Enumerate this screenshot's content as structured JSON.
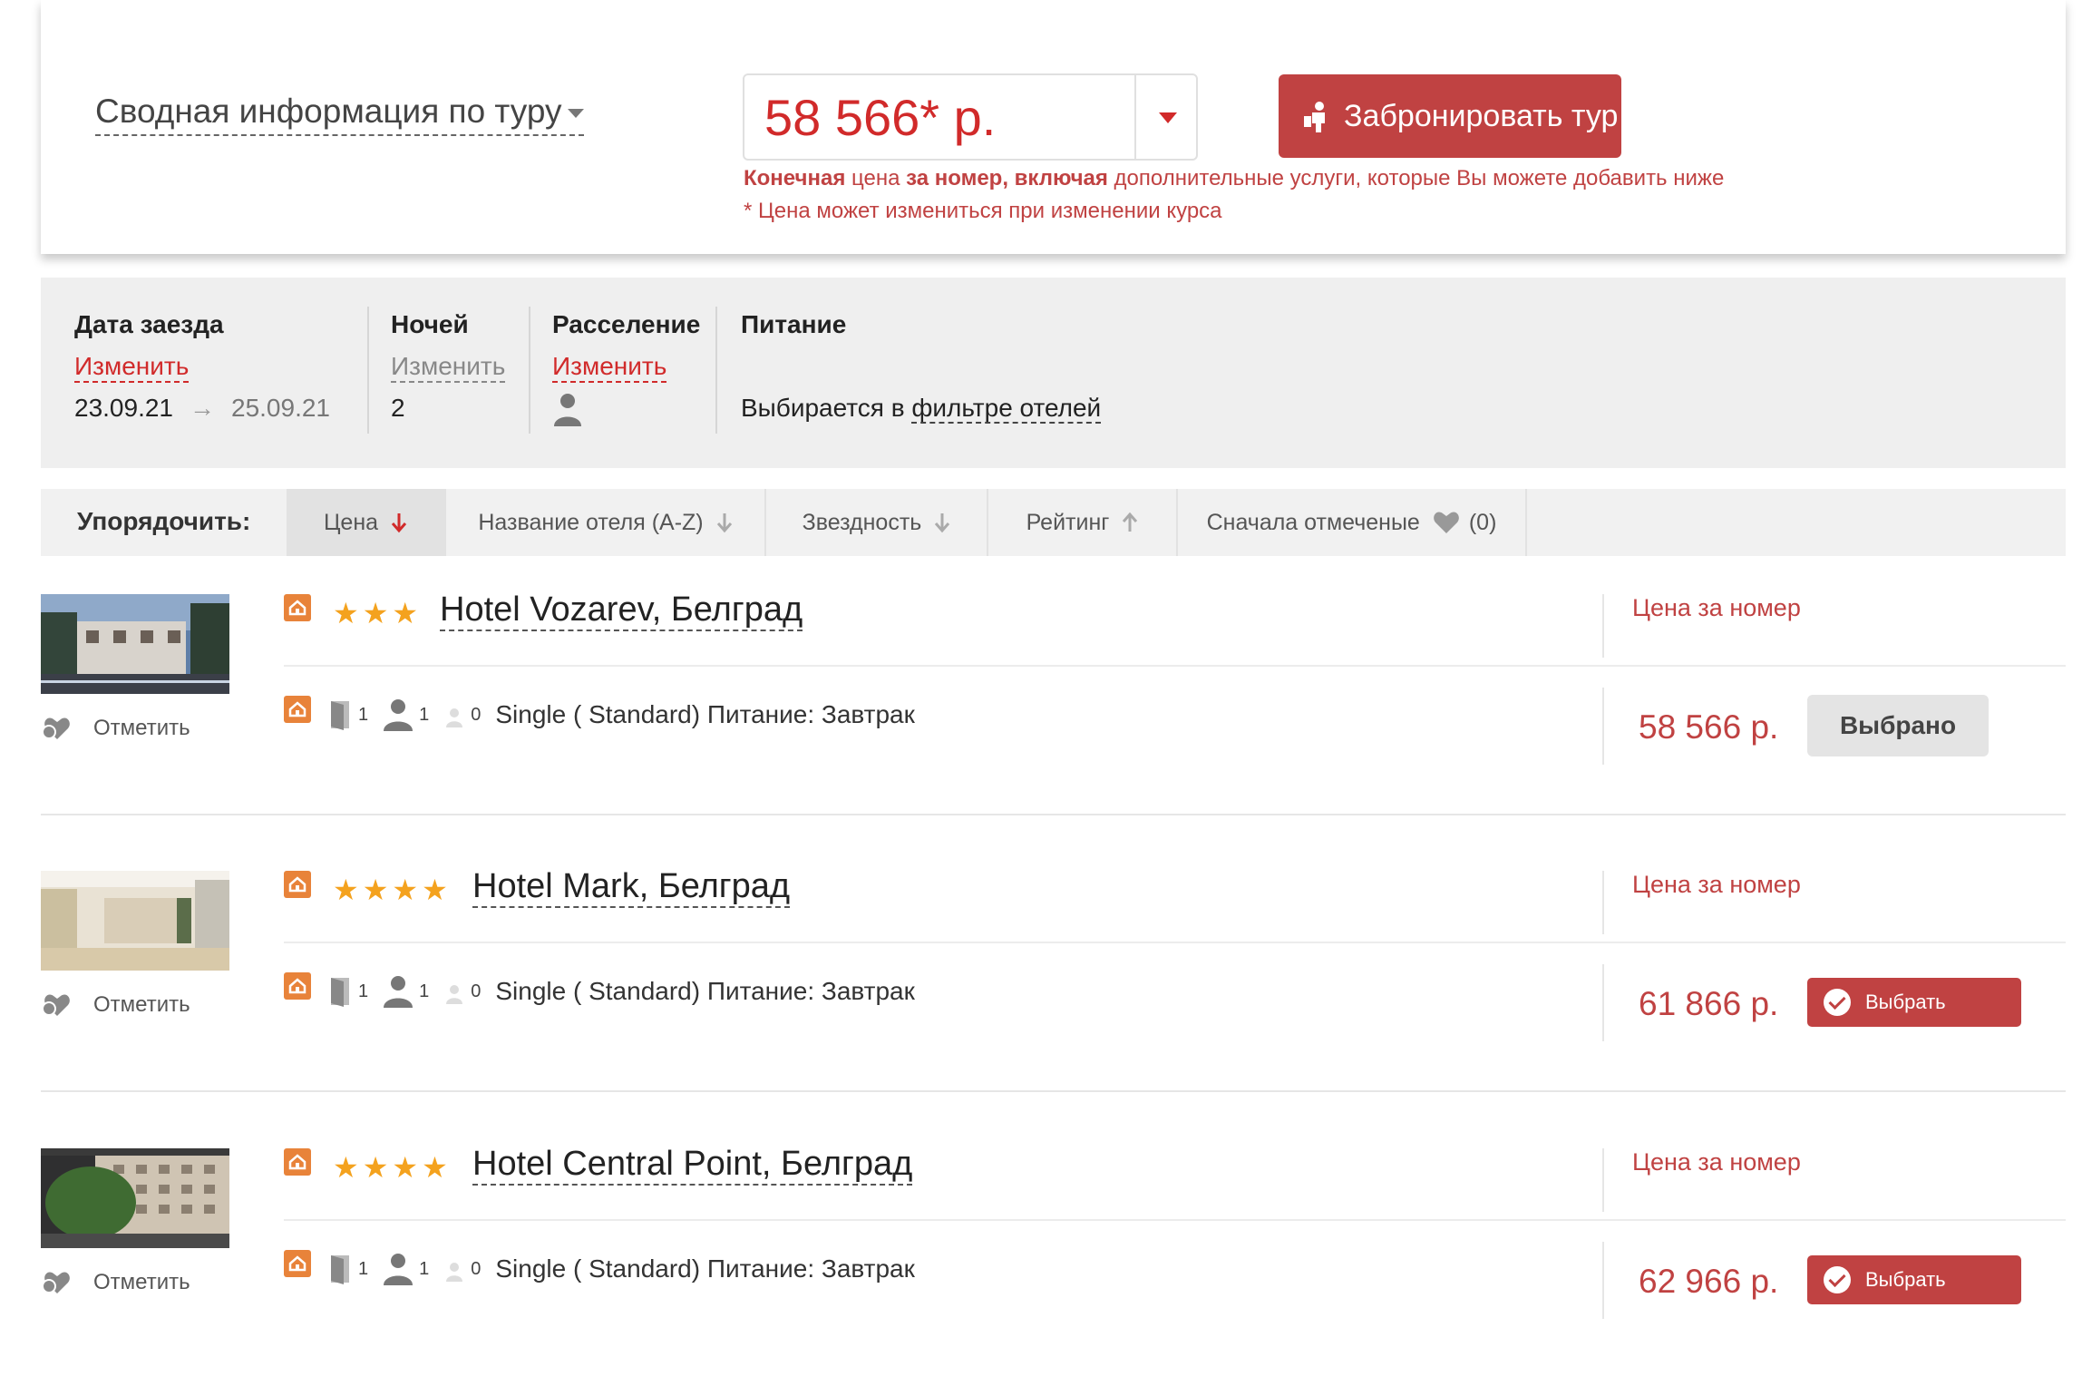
{
  "summary": {
    "title": "Сводная информация по туру",
    "price": "58 566* р.",
    "book_button": "Забронировать тур",
    "note_bold1": "Конечная",
    "note_text1": " цена ",
    "note_bold2": "за номер, включая",
    "note_text2": " дополнительные услуги, которые Вы можете добавить ниже",
    "note_line2": "* Цена может измениться при изменении курса"
  },
  "params": {
    "date_label": "Дата заезда",
    "date_change": "Изменить",
    "date_from": "23.09.21",
    "date_to": "25.09.21",
    "nights_label": "Ночей",
    "nights_change": "Изменить",
    "nights_value": "2",
    "accommodation_label": "Расселение",
    "accommodation_change": "Изменить",
    "food_label": "Питание",
    "food_value_prefix": "Выбирается в ",
    "food_value_link": "фильтре отелей"
  },
  "sort": {
    "title": "Упорядочить:",
    "options": [
      "Цена",
      "Название отеля (A-Z)",
      "Звездность",
      "Рейтинг",
      "Сначала отмеченые"
    ],
    "favorites_count": "(0)"
  },
  "hotels": [
    {
      "name": "Hotel Vozarev, Белград",
      "stars": 3,
      "mark_label": "Отметить",
      "price_label": "Цена за номер",
      "rooms": "1",
      "adults": "1",
      "children": "0",
      "room_desc": "Single ( Standard) Питание: Завтрак",
      "price": "58 566 р.",
      "button": "Выбрано",
      "selected": true
    },
    {
      "name": "Hotel Mark, Белград",
      "stars": 4,
      "mark_label": "Отметить",
      "price_label": "Цена за номер",
      "rooms": "1",
      "adults": "1",
      "children": "0",
      "room_desc": "Single ( Standard) Питание: Завтрак",
      "price": "61 866 р.",
      "button": "Выбрать",
      "selected": false
    },
    {
      "name": "Hotel Central Point, Белград",
      "stars": 4,
      "mark_label": "Отметить",
      "price_label": "Цена за номер",
      "rooms": "1",
      "adults": "1",
      "children": "0",
      "room_desc": "Single ( Standard) Питание: Завтрак",
      "price": "62 966 р.",
      "button": "Выбрать",
      "selected": false
    }
  ],
  "colors": {
    "accent_red": "#c04242",
    "price_red": "#d12a2a",
    "star_orange": "#f4a21e",
    "home_icon_orange": "#e8833a"
  }
}
